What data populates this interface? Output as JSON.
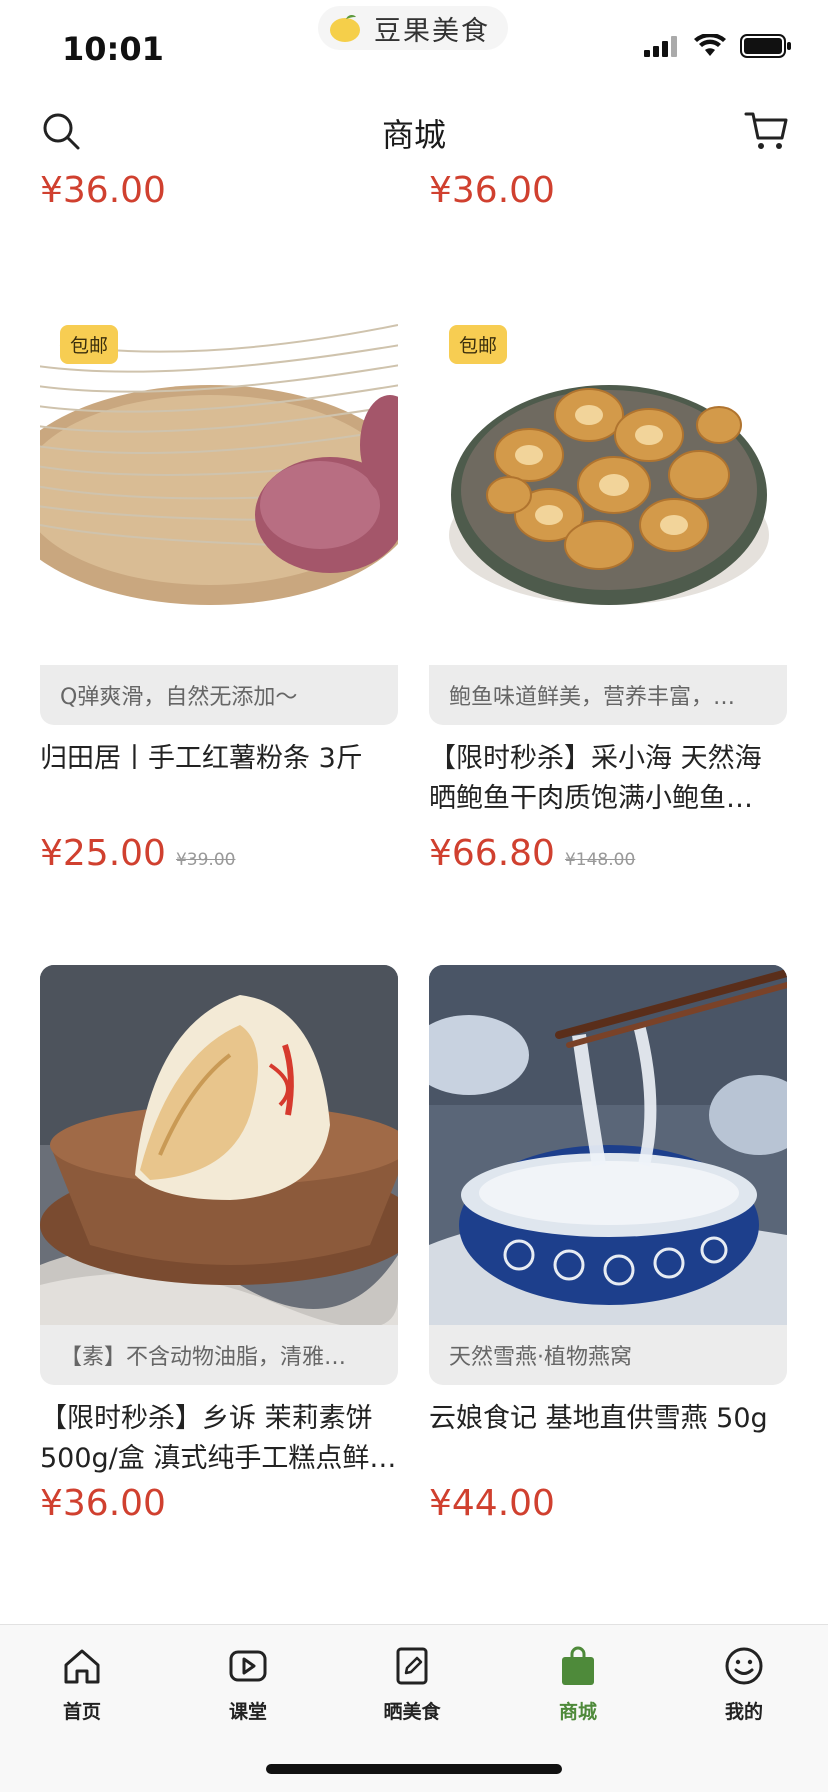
{
  "status_bar": {
    "time": "10:01",
    "app_name": "豆果美食"
  },
  "header": {
    "title": "商城"
  },
  "top_prices": [
    "¥36.00",
    "¥36.00"
  ],
  "products": [
    {
      "badge": "包邮",
      "tagline": "Q弹爽滑，自然无添加～",
      "name": "归田居丨手工红薯粉条 3斤",
      "price": "¥25.00",
      "original_price": "¥39.00"
    },
    {
      "badge": "包邮",
      "tagline": "鲍鱼味道鲜美，营养丰富，…",
      "name": "【限时秒杀】采小海 天然海晒鲍鱼干肉质饱满小鲍鱼…",
      "price": "¥66.80",
      "original_price": "¥148.00"
    },
    {
      "badge": "",
      "tagline": "【素】不含动物油脂，清雅…",
      "name": "【限时秒杀】乡诉 茉莉素饼500g/盒 滇式纯手工糕点鲜…",
      "price": "¥36.00",
      "original_price": ""
    },
    {
      "badge": "",
      "tagline": "天然雪燕·植物燕窝",
      "name": "云娘食记 基地直供雪燕 50g",
      "price": "¥44.00",
      "original_price": ""
    }
  ],
  "tabbar": {
    "items": [
      {
        "label": "首页",
        "icon": "home-icon"
      },
      {
        "label": "课堂",
        "icon": "play-icon"
      },
      {
        "label": "晒美食",
        "icon": "edit-icon"
      },
      {
        "label": "商城",
        "icon": "shopping-bag-icon",
        "active": true
      },
      {
        "label": "我的",
        "icon": "smiley-icon"
      }
    ]
  },
  "colors": {
    "price": "#d0402f",
    "badge": "#f7cd52",
    "active_tab": "#4e8a3a"
  }
}
